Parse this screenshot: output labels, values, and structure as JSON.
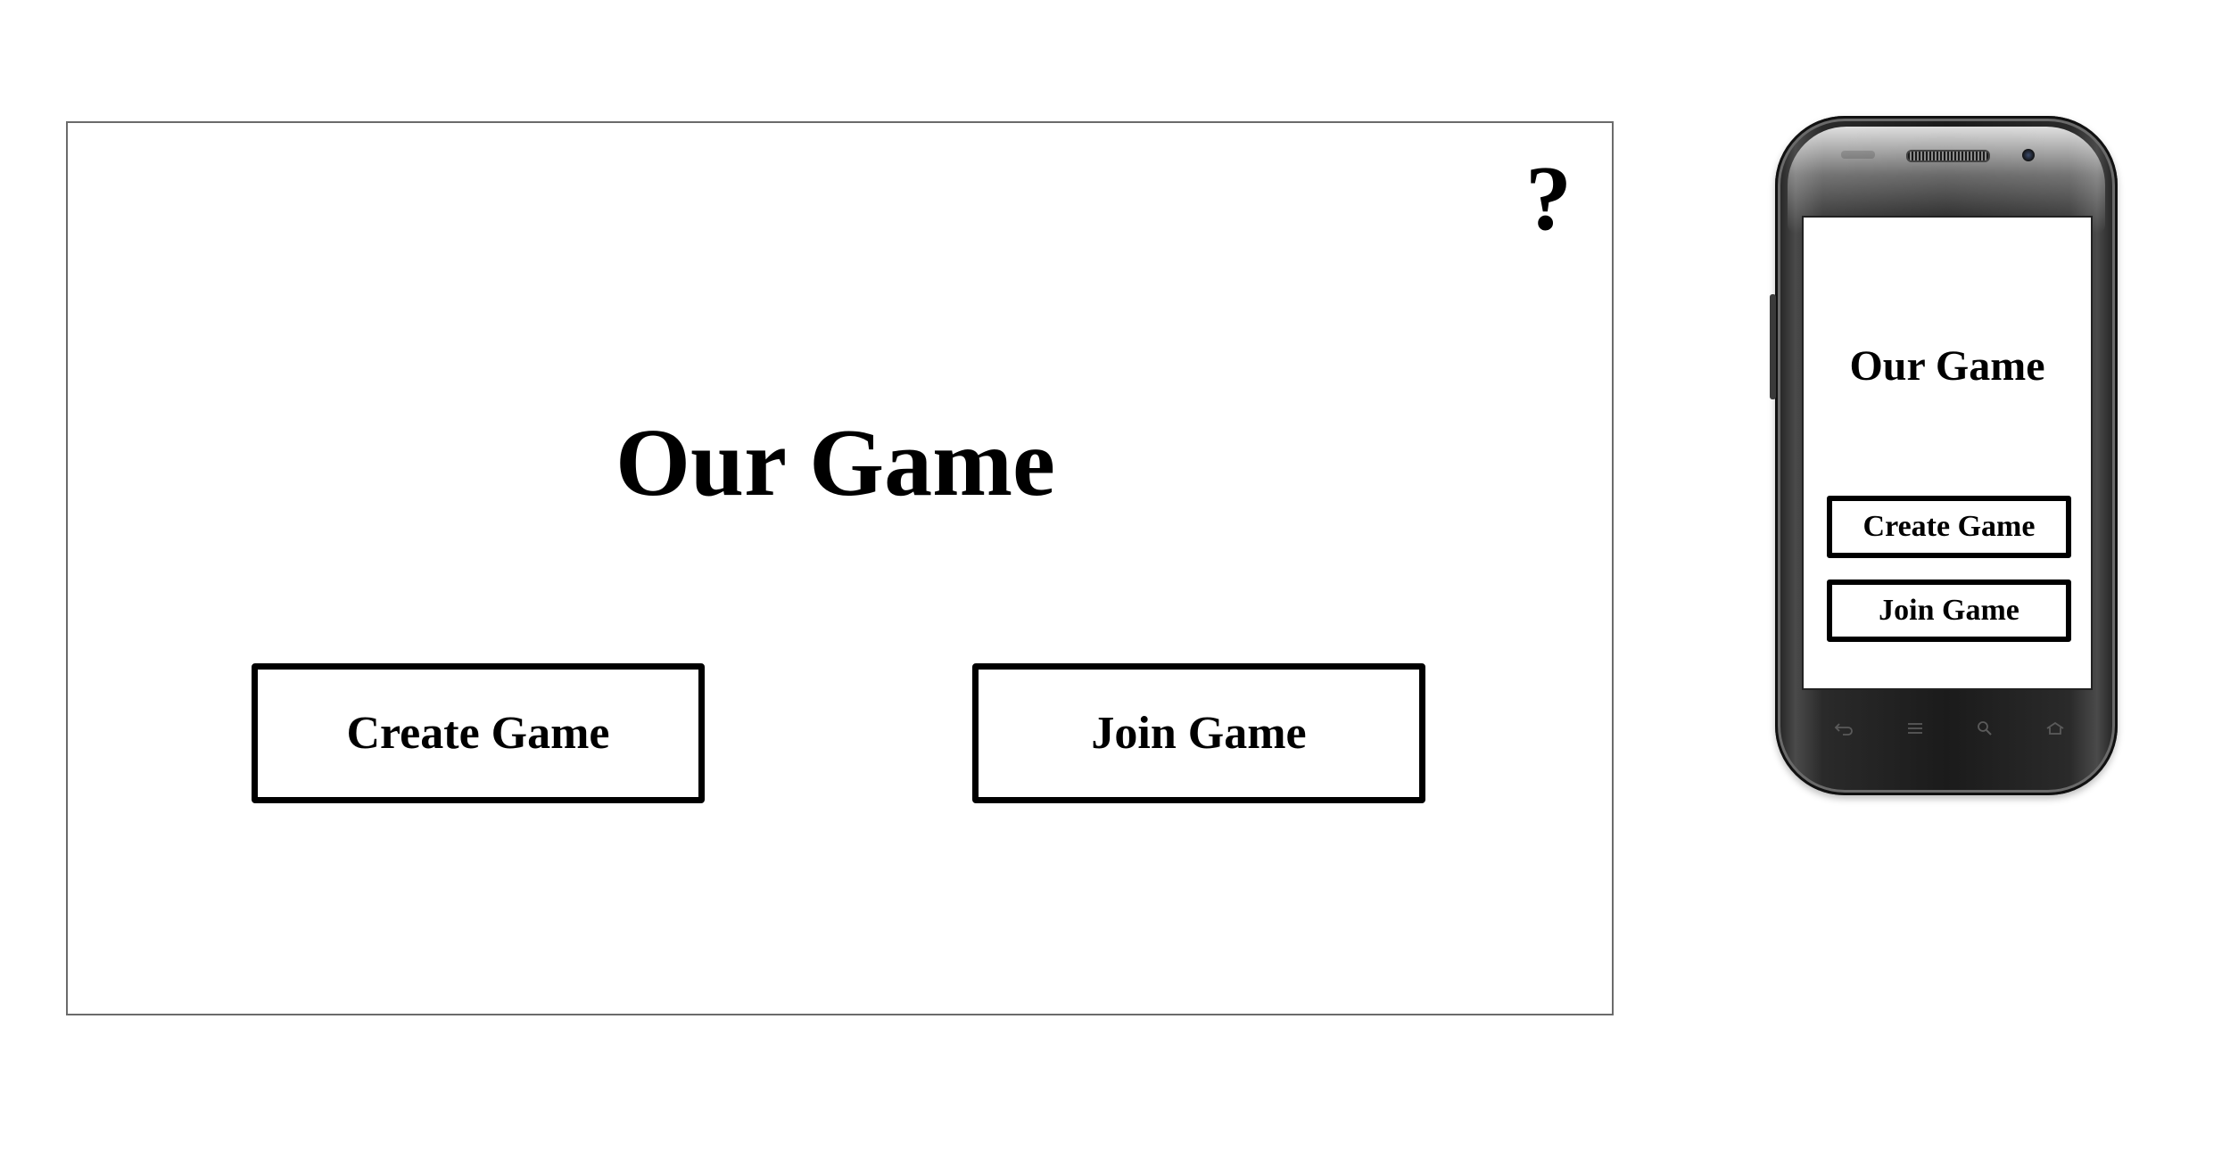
{
  "desktop": {
    "help_icon": "?",
    "title": "Our Game",
    "create_button": "Create Game",
    "join_button": "Join Game"
  },
  "phone": {
    "title": "Our Game",
    "create_button": "Create Game",
    "join_button": "Join Game",
    "nav_icons": [
      "back-icon",
      "menu-icon",
      "search-icon",
      "home-icon"
    ]
  },
  "colors": {
    "background": "#ffffff",
    "text": "#000000",
    "frame_border": "#6b6b6b",
    "phone_body": "#1b1b1b"
  }
}
